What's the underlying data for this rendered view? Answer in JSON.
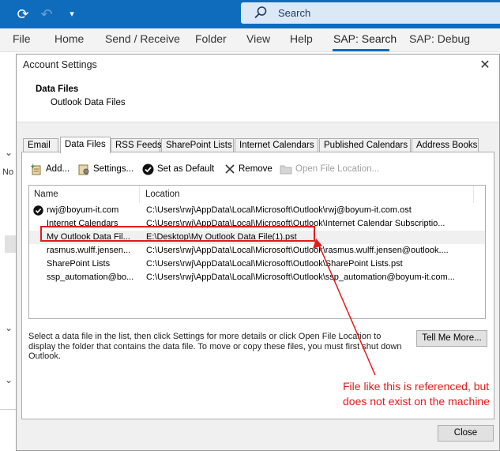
{
  "search": {
    "label": "Search"
  },
  "ribbon": {
    "tabs": [
      "File",
      "Home",
      "Send / Receive",
      "Folder",
      "View",
      "Help",
      "SAP: Search",
      "SAP: Debug"
    ],
    "active": "SAP: Search"
  },
  "background": {
    "left_text": "No"
  },
  "dialog": {
    "title": "Account Settings",
    "section_title": "Data Files",
    "section_subtitle": "Outlook Data Files",
    "tabs": [
      "Email",
      "Data Files",
      "RSS Feeds",
      "SharePoint Lists",
      "Internet Calendars",
      "Published Calendars",
      "Address Books"
    ],
    "active_tab": "Data Files",
    "toolbar": {
      "add": "Add...",
      "settings": "Settings...",
      "set_default": "Set as Default",
      "remove": "Remove",
      "open_location": "Open File Location..."
    },
    "columns": {
      "name": "Name",
      "location": "Location"
    },
    "rows": [
      {
        "name": "rwj@boyum-it.com",
        "location": "C:\\Users\\rwj\\AppData\\Local\\Microsoft\\Outlook\\rwj@boyum-it.com.ost",
        "default": true
      },
      {
        "name": "Internet Calendars",
        "location": "C:\\Users\\rwj\\AppData\\Local\\Microsoft\\Outlook\\Internet Calendar Subscriptio..."
      },
      {
        "name": "My Outlook Data Fil...",
        "location": "E:\\Desktop\\My Outlook Data File(1).pst",
        "selected": true
      },
      {
        "name": "rasmus.wulff.jensen...",
        "location": "C:\\Users\\rwj\\AppData\\Local\\Microsoft\\Outlook\\rasmus.wulff.jensen@outlook...."
      },
      {
        "name": "SharePoint Lists",
        "location": "C:\\Users\\rwj\\AppData\\Local\\Microsoft\\Outlook\\SharePoint Lists.pst"
      },
      {
        "name": "ssp_automation@bo...",
        "location": "C:\\Users\\rwj\\AppData\\Local\\Microsoft\\Outlook\\ssp_automation@boyum-it.com..."
      }
    ],
    "help_text": "Select a data file in the list, then click Settings for more details or click Open File Location to display the folder that contains the data file. To move or copy these files, you must first shut down Outlook.",
    "tell_me_more": "Tell Me More...",
    "close": "Close"
  },
  "annotation": {
    "text": "File like this is referenced, but does not exist on the machine",
    "color": "#e31b1b"
  },
  "colors": {
    "titlebar": "#0f6cbd",
    "search_bg": "#dbe9f7",
    "dialog_bg": "#f0f0f0"
  }
}
